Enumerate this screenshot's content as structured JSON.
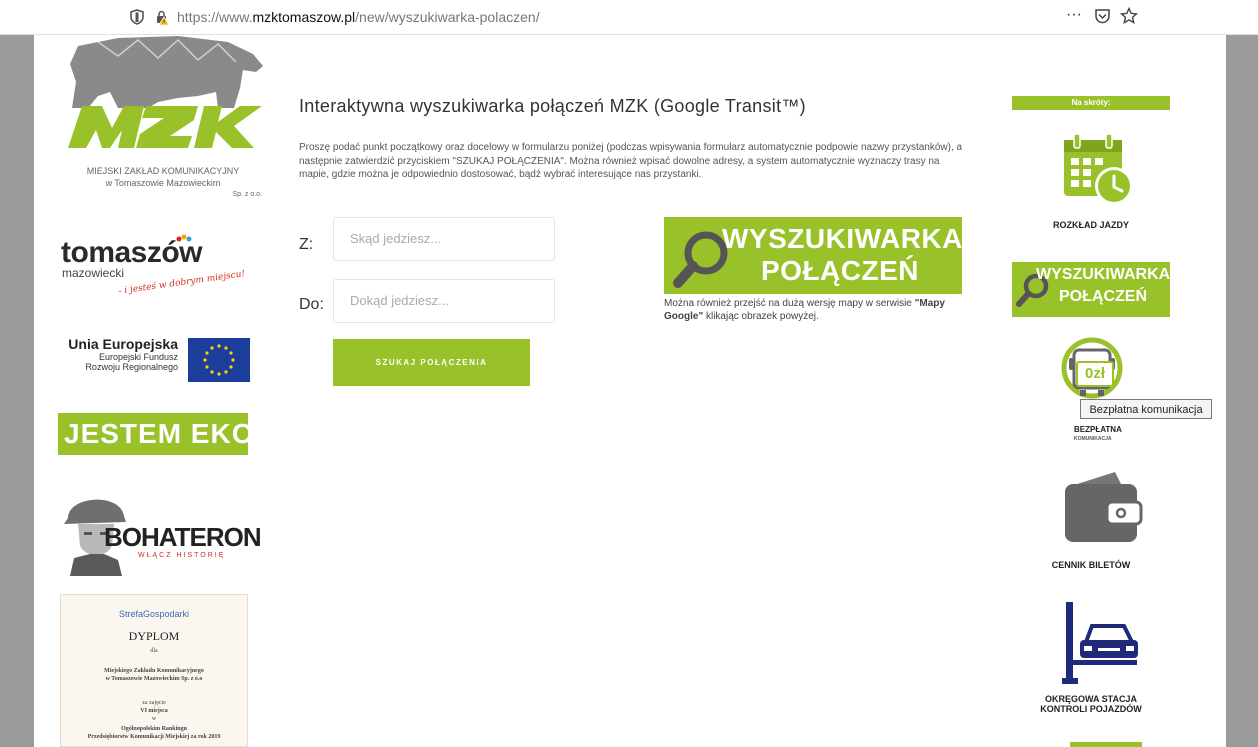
{
  "browser": {
    "url_prefix": "https://www.",
    "url_domain": "mzktomaszow.pl",
    "url_path": "/new/wyszukiwarka-polaczen/",
    "more_label": "···",
    "pocket_icon": "pocket-icon",
    "star_icon": "star-icon"
  },
  "left": {
    "mzk_line1": "MIEJSKI ZAKŁAD KOMUNIKACYJNY",
    "mzk_line2": "w Tomaszowie Mazowieckim",
    "mzk_line3": "Sp. z o.o.",
    "mzk_logo_text": "MZK",
    "tomaszow_main": "tomaszów",
    "tomaszow_sub": "mazowiecki",
    "tomaszow_slogan": "- i jesteś w dobrym miejscu!",
    "ue_title": "Unia Europejska",
    "ue_line2": "Europejski Fundusz",
    "ue_line3": "Rozwoju Regionalnego",
    "jestem": "JESTEM EKO",
    "bohateron": "BOHATERON",
    "bohateron_sub": "WŁĄCZ HISTORIĘ",
    "dyplom_brand": "StrefaGospodarki",
    "dyplom_title": "DYPLOM",
    "dyplom_dla": "dla",
    "dyplom_org1": "Miejskiego Zakładu Komunikacyjnego",
    "dyplom_org2": "w Tomaszowie Mazowieckim Sp. z o.o",
    "dyplom_za": "za zajęcie",
    "dyplom_place": "VI miejsca",
    "dyplom_w": "w",
    "dyplom_rank1": "Ogólnopolskim Rankingu",
    "dyplom_rank2": "Przedsiębiorstw Komunikacji Miejskiej za rok 2019"
  },
  "main": {
    "title": "Interaktywna wyszukiwarka połączeń MZK (Google Transit™)",
    "intro": "Proszę podać punkt początkowy oraz docelowy w formularzu poniżej (podczas wpisywania formularz automatycznie podpowie nazwy przystanków), a następnie zatwierdzić przyciskiem \"SZUKAJ POŁĄCZENIA\". Można również wpisać dowolne adresy, a system automatycznie wyznaczy trasy na mapie, gdzie można je odpowiednio dostosować, bądź wybrać interesujące nas przystanki.",
    "from_label": "Z:",
    "from_placeholder": "Skąd jedziesz...",
    "to_label": "Do:",
    "to_placeholder": "Dokąd jedziesz...",
    "search_button": "SZUKAJ POŁĄCZENIA",
    "banner_line1": "WYSZUKIWARKA",
    "banner_line2": "POŁĄCZEŃ",
    "caption_part1": "Można również przejść na dużą wersję mapy w serwisie ",
    "caption_bold": "\"Mapy Google\"",
    "caption_part2": " klikając obrazek powyżej."
  },
  "right": {
    "shortcuts_title": "Na skróty:",
    "rozklad": "ROZKŁAD JAZDY",
    "banner_line1": "WYSZUKIWARKA",
    "banner_line2": "POŁĄCZEŃ",
    "free_badge": "0zł",
    "tooltip": "Bezpłatna komunikacja",
    "free_line1": "BEZPŁATNA",
    "free_line2": "KOMUNIKACJA",
    "cennik": "CENNIK BILETÓW",
    "skp_line1": "OKRĘGOWA STACJA",
    "skp_line2": "KONTROLI POJAZDÓW"
  },
  "colors": {
    "brand_green": "#98c12a",
    "bear_gray": "#8a8a8a",
    "eu_blue": "#1d3d9a"
  }
}
